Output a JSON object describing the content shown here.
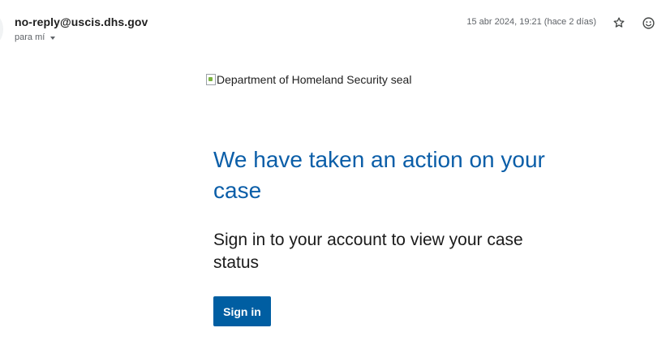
{
  "email": {
    "sender": "no-reply@uscis.dhs.gov",
    "recipient_label": "para mí",
    "date": "15 abr 2024, 19:21 (hace 2 días)",
    "actions": [
      {
        "name": "star-icon",
        "label": "Star"
      },
      {
        "name": "emoji-reaction-icon",
        "label": "Add reaction"
      }
    ]
  },
  "body": {
    "seal_alt": "Department of Homeland Security seal",
    "headline": "We have taken an action on your case",
    "subline": "Sign in to your account to view your case status",
    "signin_button": "Sign in"
  },
  "colors": {
    "headline": "#0b5ea8",
    "button_bg": "#005ea2",
    "button_text": "#ffffff",
    "meta_text": "#5f6368"
  }
}
